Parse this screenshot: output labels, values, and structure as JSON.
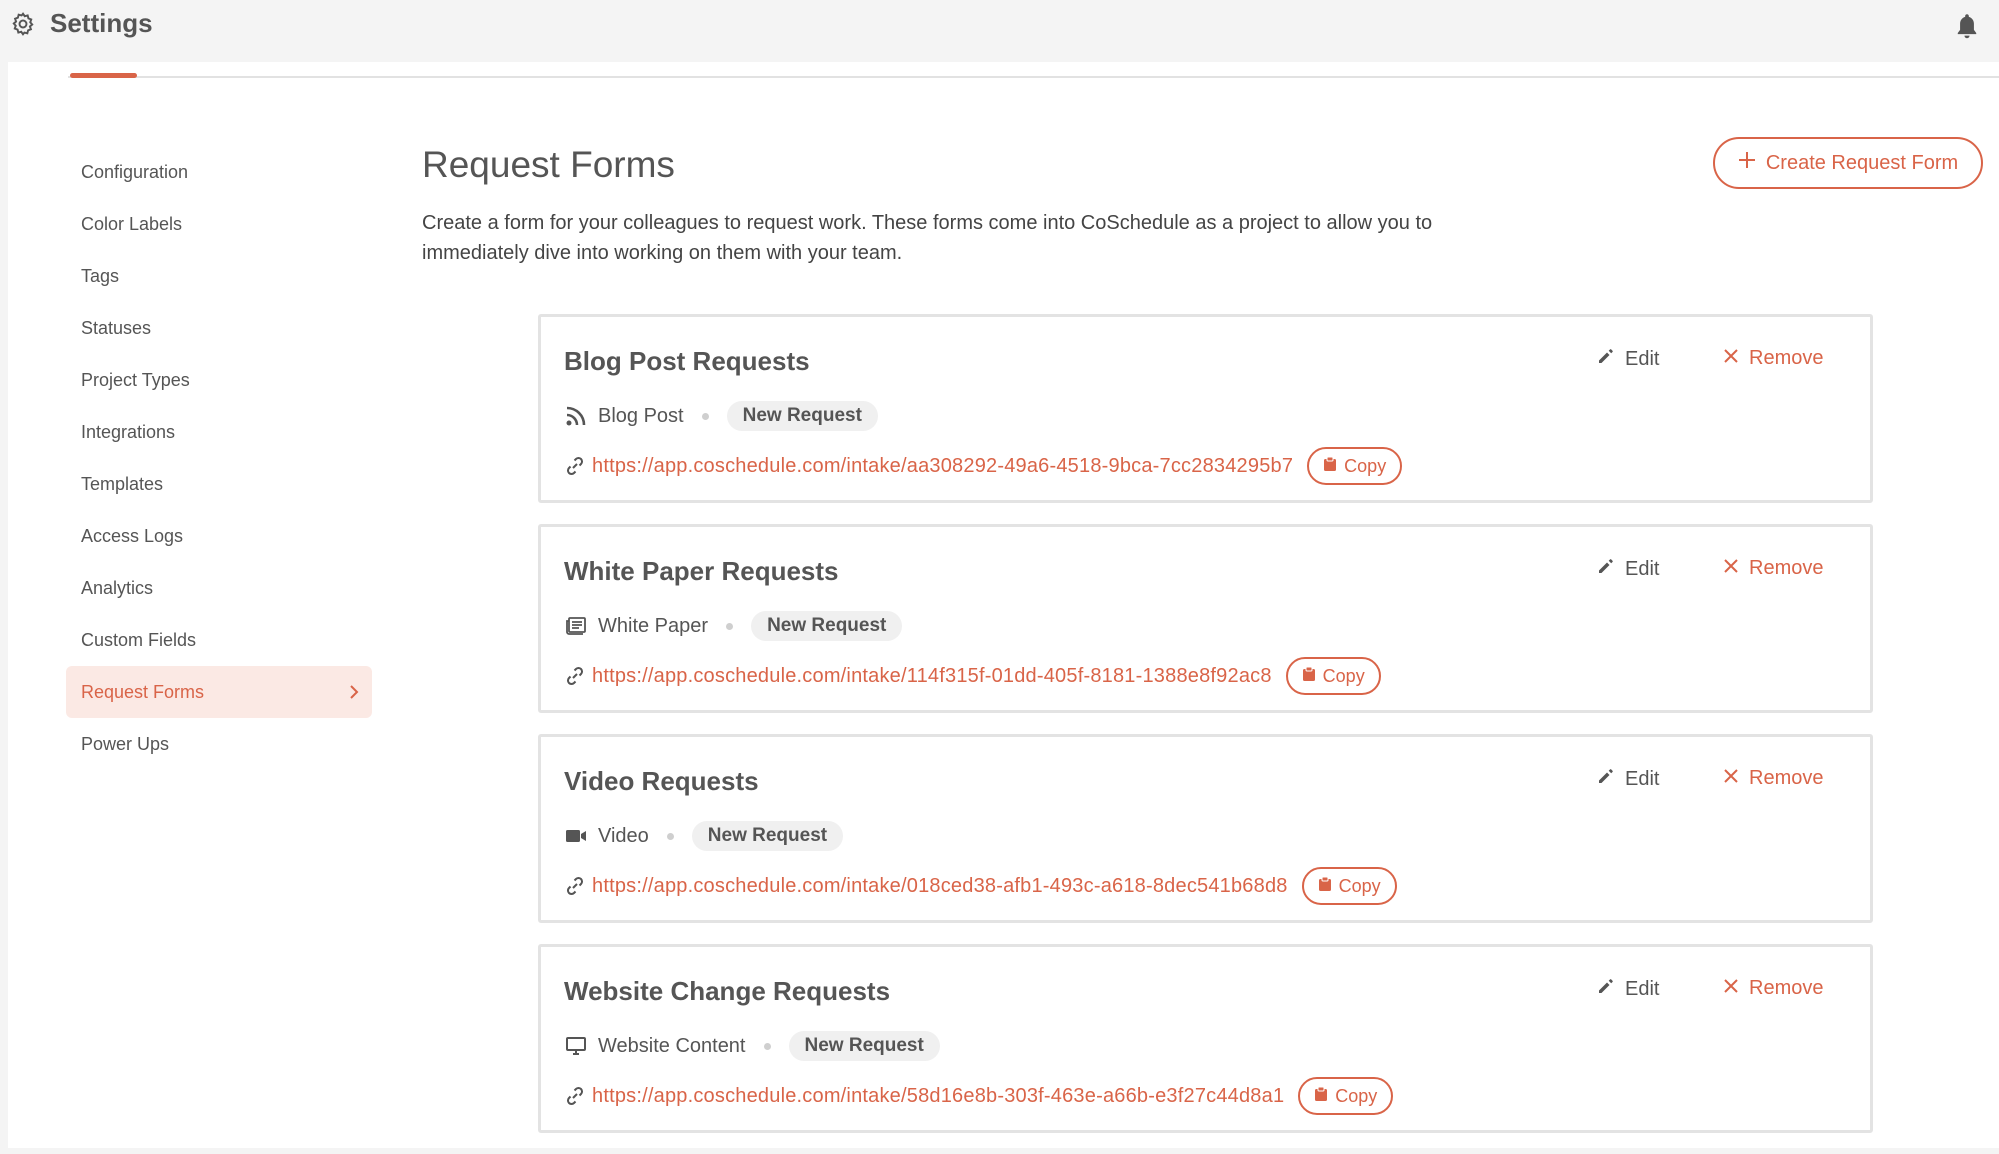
{
  "header": {
    "title": "Settings",
    "settings_icon": "gear-icon",
    "notification_icon": "bell-icon"
  },
  "sidebar": {
    "items": [
      {
        "label": "Configuration"
      },
      {
        "label": "Color Labels"
      },
      {
        "label": "Tags"
      },
      {
        "label": "Statuses"
      },
      {
        "label": "Project Types"
      },
      {
        "label": "Integrations"
      },
      {
        "label": "Templates"
      },
      {
        "label": "Access Logs"
      },
      {
        "label": "Analytics"
      },
      {
        "label": "Custom Fields"
      },
      {
        "label": "Request Forms",
        "active": true
      },
      {
        "label": "Power Ups"
      }
    ]
  },
  "main": {
    "title": "Request Forms",
    "description": "Create a form for your colleagues to request work. These forms come into CoSchedule as a project to allow you to immediately dive into working on them with your team.",
    "create_button": "Create Request Form",
    "forms": [
      {
        "title": "Blog Post Requests",
        "type": "Blog Post",
        "type_icon": "rss-icon",
        "status": "New Request",
        "url": "https://app.coschedule.com/intake/aa308292-49a6-4518-9bca-7cc2834295b7"
      },
      {
        "title": "White Paper Requests",
        "type": "White Paper",
        "type_icon": "document-icon",
        "status": "New Request",
        "url": "https://app.coschedule.com/intake/114f315f-01dd-405f-8181-1388e8f92ac8"
      },
      {
        "title": "Video Requests",
        "type": "Video",
        "type_icon": "video-camera-icon",
        "status": "New Request",
        "url": "https://app.coschedule.com/intake/018ced38-afb1-493c-a618-8dec541b68d8"
      },
      {
        "title": "Website Change Requests",
        "type": "Website Content",
        "type_icon": "monitor-icon",
        "status": "New Request",
        "url": "https://app.coschedule.com/intake/58d16e8b-303f-463e-a66b-e3f27c44d8a1"
      }
    ],
    "labels": {
      "edit": "Edit",
      "remove": "Remove",
      "copy": "Copy"
    }
  },
  "colors": {
    "accent": "#d96448",
    "active_bg": "#fbe9e4",
    "text": "#555555"
  }
}
